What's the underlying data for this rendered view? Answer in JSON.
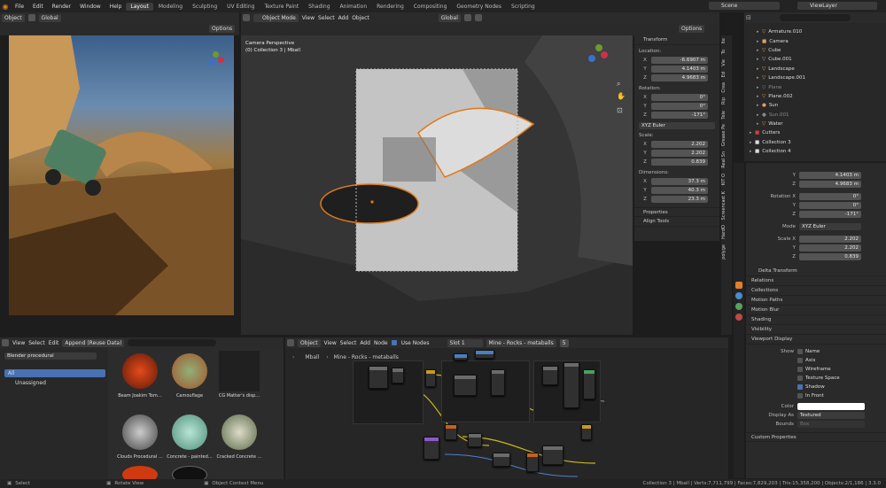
{
  "topbar": {
    "menus": [
      "File",
      "Edit",
      "Render",
      "Window",
      "Help"
    ],
    "workspaces": [
      "Layout",
      "Modeling",
      "Sculpting",
      "UV Editing",
      "Texture Paint",
      "Shading",
      "Animation",
      "Rendering",
      "Compositing",
      "Geometry Nodes",
      "Scripting"
    ],
    "active_workspace": "Layout",
    "scene": "Scene",
    "view_layer": "ViewLayer"
  },
  "left_view": {
    "mode": "Object",
    "orientation": "Global",
    "options": "Options"
  },
  "main_view": {
    "mode": "Object Mode",
    "menus": [
      "View",
      "Select",
      "Add",
      "Object"
    ],
    "orientation": "Global",
    "options": "Options",
    "overlay_title": "Camera Perspective",
    "overlay_sub": "(0) Collection 3 | Mball"
  },
  "npanel": {
    "title": "Transform",
    "location_label": "Location:",
    "location": [
      {
        "axis": "X",
        "value": "-6.6907 m"
      },
      {
        "axis": "Y",
        "value": "4.1403 m"
      },
      {
        "axis": "Z",
        "value": "4.9683 m"
      }
    ],
    "rotation_label": "Rotation:",
    "rotation": [
      {
        "axis": "X",
        "value": "0°"
      },
      {
        "axis": "Y",
        "value": "0°"
      },
      {
        "axis": "Z",
        "value": "-171°"
      }
    ],
    "rotation_mode": "XYZ Euler",
    "scale_label": "Scale:",
    "scale": [
      {
        "axis": "X",
        "value": "2.202"
      },
      {
        "axis": "Y",
        "value": "2.202"
      },
      {
        "axis": "Z",
        "value": "0.839"
      }
    ],
    "dimensions_label": "Dimensions:",
    "dimensions": [
      {
        "axis": "X",
        "value": "37.3 m"
      },
      {
        "axis": "Y",
        "value": "40.3 m"
      },
      {
        "axis": "Z",
        "value": "23.3 m"
      }
    ],
    "properties": "Properties",
    "align_tools": "Align Tools",
    "tabs": [
      "Ite",
      "To",
      "Vie",
      "Ed",
      "Crea",
      "Rip",
      "Tele",
      "Grease Pe",
      "Real Sn",
      "KIT O",
      "Screencast K",
      "HardO",
      "polyge"
    ]
  },
  "outliner": {
    "items": [
      {
        "name": "Armature.010",
        "indent": 2,
        "color": "#e0a060"
      },
      {
        "name": "Camera",
        "indent": 2,
        "color": "#e0a060"
      },
      {
        "name": "Cube",
        "indent": 2,
        "color": "#e0a060"
      },
      {
        "name": "Cube.001",
        "indent": 2,
        "color": "#e0a060"
      },
      {
        "name": "Landscape",
        "indent": 2,
        "color": "#e0a060"
      },
      {
        "name": "Landscape.001",
        "indent": 2,
        "color": "#e0a060"
      },
      {
        "name": "Plane",
        "indent": 2,
        "color": "#777"
      },
      {
        "name": "Plane.002",
        "indent": 2,
        "color": "#e0a060"
      },
      {
        "name": "Sun",
        "indent": 2,
        "color": "#e0a060"
      },
      {
        "name": "Sun.001",
        "indent": 2,
        "color": "#777"
      },
      {
        "name": "Water",
        "indent": 2,
        "color": "#e0a060"
      },
      {
        "name": "Cutters",
        "indent": 1,
        "color": "#d04040"
      },
      {
        "name": "Collection 3",
        "indent": 1,
        "color": "#ddd"
      },
      {
        "name": "Collection 4",
        "indent": 1,
        "color": "#ddd"
      }
    ]
  },
  "props": {
    "loc_y": "4.1403 m",
    "loc_z": "4.9683 m",
    "rotation_label": "Rotation X",
    "rot": [
      {
        "axis": "X",
        "value": "0°"
      },
      {
        "axis": "Y",
        "value": "0°"
      },
      {
        "axis": "Z",
        "value": "-171°"
      }
    ],
    "mode_label": "Mode",
    "mode": "XYZ Euler",
    "scale_label": "Scale X",
    "scale": [
      {
        "axis": "X",
        "value": "2.202"
      },
      {
        "axis": "Y",
        "value": "2.202"
      },
      {
        "axis": "Z",
        "value": "0.839"
      }
    ],
    "sections": [
      "Delta Transform",
      "Relations",
      "Collections",
      "Motion Paths",
      "Motion Blur",
      "Shading",
      "Visibility",
      "Viewport Display"
    ],
    "show_label": "Show",
    "show_opts": [
      {
        "label": "Name",
        "on": false
      },
      {
        "label": "Axis",
        "on": false
      },
      {
        "label": "Wireframe",
        "on": false
      },
      {
        "label": "Texture Space",
        "on": false
      },
      {
        "label": "Shadow",
        "on": true
      },
      {
        "label": "In Front",
        "on": false
      }
    ],
    "color_label": "Color",
    "display_as_label": "Display As",
    "display_as": "Textured",
    "bounds_label": "Bounds",
    "bounds": "Box",
    "custom": "Custom Properties"
  },
  "asset": {
    "menus": [
      "View",
      "Select",
      "Edit"
    ],
    "import": "Append (Reuse Data)",
    "library": "Blender procedural",
    "catalog_all": "All",
    "unassigned": "Unassigned",
    "assets": [
      "Beam Joakim Tom…",
      "Camouflage",
      "CG Matter's disp…",
      "Clouds Procedural …",
      "Concrete - painted…",
      "Cracked Concrete …"
    ]
  },
  "node": {
    "type": "Object",
    "menus": [
      "View",
      "Select",
      "Add",
      "Node"
    ],
    "use_nodes": "Use Nodes",
    "slot": "Slot 1",
    "material": "Mine - Rocks - metaballs",
    "users": "5",
    "breadcrumb": [
      "Mball",
      "Mine - Rocks - metaballs"
    ]
  },
  "status": {
    "select": "Select",
    "rotate": "Rotate View",
    "context": "Object Context Menu",
    "info": "Collection 3 | Mball | Verts:7,711,799 | Faces:7,829,203 | Tris:15,358,200 | Objects:2/1,186 | 3.3.0"
  }
}
